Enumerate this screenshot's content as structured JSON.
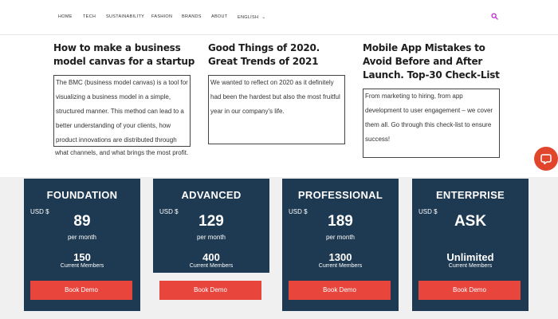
{
  "nav": {
    "items": [
      "HOME",
      "TECH",
      "SUSTAINABILITY",
      "FASHION",
      "BRANDS",
      "ABOUT",
      "ENGLISH"
    ],
    "dropdown_icon": "chevron-down-icon",
    "search_icon": "search-icon",
    "accent_color": "#c026d3"
  },
  "articles": [
    {
      "title": "How to make a business model canvas for a startup",
      "excerpt_boxed": "The BMC (business model canvas) is a tool for visualizing a business model in a simple, structured manner. This method can lead to a better understanding of your clients, how product innovations are distributed through",
      "excerpt_overflow": "what channels, and what brings the most profit."
    },
    {
      "title": "Good Things of 2020. Great Trends of 2021",
      "excerpt_boxed": "We wanted to reflect on 2020 as it definitely had been the hardest but also the most fruitful year in our company's life.",
      "excerpt_overflow": ""
    },
    {
      "title": "Mobile App Mistakes to Avoid Before and After Launch. Top-30 Check-List",
      "excerpt_boxed": "From marketing to hiring, from app development to user engagement – we cover them all. Go through this check-list to ensure success!",
      "excerpt_overflow": ""
    }
  ],
  "chat": {
    "icon": "chat-bubble-icon",
    "color": "#e1462d"
  },
  "pricing": {
    "card_color": "#1e3a52",
    "button_color": "#e8453d",
    "plans": [
      {
        "name": "FOUNDATION",
        "currency": "USD $",
        "price": "89",
        "period": "per month",
        "members": "150",
        "members_label": "Current Members",
        "button": "Book Demo"
      },
      {
        "name": "ADVANCED",
        "currency": "USD $",
        "price": "129",
        "period": "per month",
        "members": "400",
        "members_label": "Current Members",
        "button": "Book Demo"
      },
      {
        "name": "PROFESSIONAL",
        "currency": "USD $",
        "price": "189",
        "period": "per month",
        "members": "1300",
        "members_label": "Current Members",
        "button": "Book Demo"
      },
      {
        "name": "ENTERPRISE",
        "currency": "USD $",
        "price": "ASK",
        "period": "",
        "members": "Unlimited",
        "members_label": "Current Members",
        "button": "Book Demo"
      }
    ]
  }
}
